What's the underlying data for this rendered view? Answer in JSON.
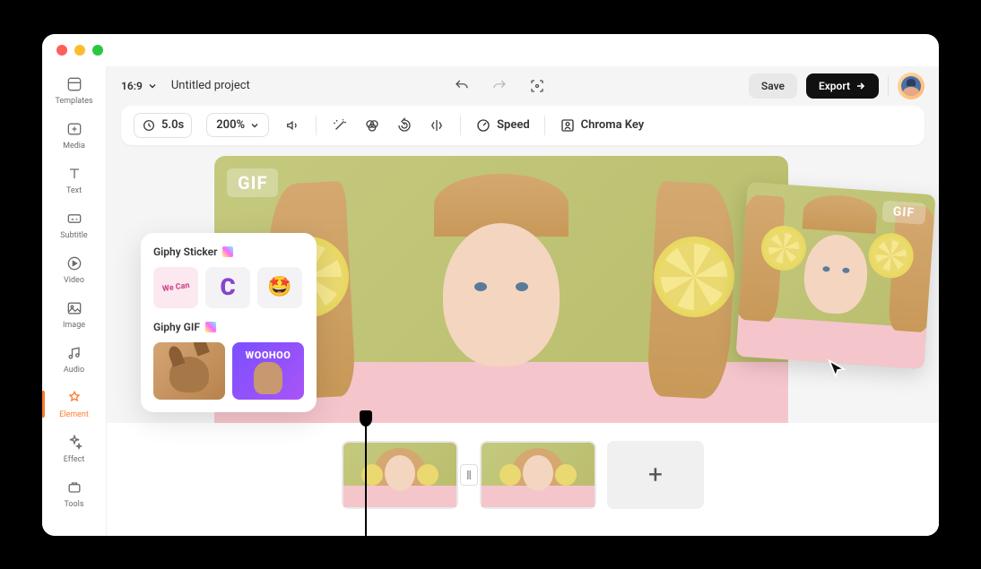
{
  "titlebar": {
    "colors": [
      "#ff5f57",
      "#febc2e",
      "#28c840"
    ]
  },
  "sidebar": {
    "items": [
      {
        "label": "Templates",
        "icon": "templates-icon"
      },
      {
        "label": "Media",
        "icon": "media-icon"
      },
      {
        "label": "Text",
        "icon": "text-icon"
      },
      {
        "label": "Subtitle",
        "icon": "subtitle-icon"
      },
      {
        "label": "Video",
        "icon": "video-icon"
      },
      {
        "label": "Image",
        "icon": "image-icon"
      },
      {
        "label": "Audio",
        "icon": "audio-icon"
      },
      {
        "label": "Element",
        "icon": "element-icon",
        "active": true
      },
      {
        "label": "Effect",
        "icon": "effect-icon"
      },
      {
        "label": "Tools",
        "icon": "tools-icon"
      }
    ]
  },
  "topbar": {
    "aspect": "16:9",
    "project_name": "Untitled project",
    "save_label": "Save",
    "export_label": "Export"
  },
  "toolbar": {
    "duration": "5.0s",
    "zoom": "200%",
    "speed_label": "Speed",
    "chroma_label": "Chroma Key"
  },
  "panel": {
    "sticker_title": "Giphy Sticker",
    "gif_title": "Giphy GIF",
    "stickers": [
      "wecan",
      "letter-c",
      "star-eyes"
    ],
    "gifs": [
      {
        "name": "eevee"
      },
      {
        "name": "woohoo",
        "label": "WOOHOO"
      }
    ]
  },
  "canvas": {
    "gif_badge": "GIF",
    "thumb_gif_badge": "GIF"
  },
  "timeline": {
    "add_label": "+"
  }
}
